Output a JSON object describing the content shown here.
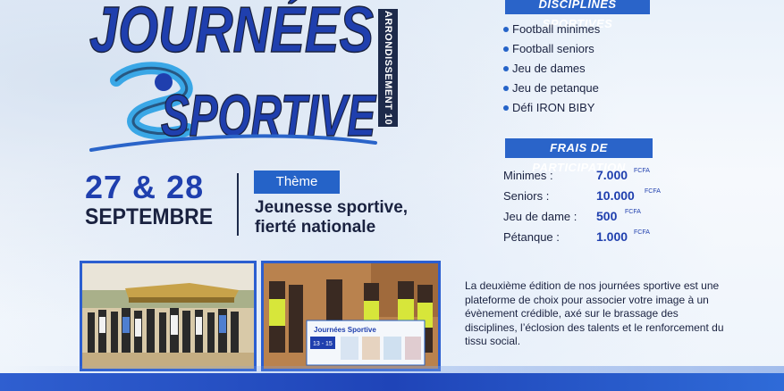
{
  "title": {
    "line1": "JOURNÉES",
    "line2": "SPORTIVE",
    "vertical_tag": "ARRONDISSEMENT 10"
  },
  "dates": {
    "days": "27 & 28",
    "month": "SEPTEMBRE"
  },
  "theme": {
    "badge": "Thème",
    "line1": "Jeunesse sportive,",
    "line2": "fierté nationale"
  },
  "disciplines": {
    "heading": "Disciplines sportives",
    "items": [
      "Football minimes",
      "Football seniors",
      "Jeu de dames",
      "Jeu de petanque",
      "Défi IRON BIBY"
    ]
  },
  "fees": {
    "heading": "Frais de participation",
    "currency": "FCFA",
    "rows": [
      {
        "label": "Minimes :",
        "amount": "7.000"
      },
      {
        "label": "Seniors :",
        "amount": "10.000"
      },
      {
        "label": "Jeu de dame :",
        "amount": "500"
      },
      {
        "label": "Pétanque :",
        "amount": "1.000"
      }
    ]
  },
  "photos": {
    "banner_text": "Journées Sportive",
    "banner_dates": "13 - 15"
  },
  "description": "La deuxième édition de nos journées sportive est une plateforme de choix pour associer votre image à un évènement crédible, axé sur le brassage des disciplines, l’éclosion des talents et le renforcement du tissu social.",
  "colors": {
    "primary_blue": "#2563c8",
    "dark_navy": "#1a2240",
    "accent_blue": "#1f3fae"
  }
}
